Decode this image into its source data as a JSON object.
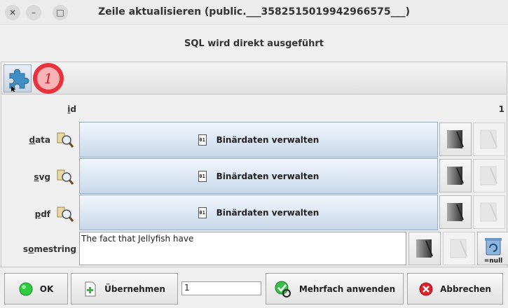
{
  "window": {
    "title": "Zeile aktualisieren (public.___3582515019942966575___)",
    "close_glyph": "✕",
    "minimize_glyph": "–",
    "maximize_glyph": "□"
  },
  "subtitle": "SQL wird direkt ausgeführt",
  "toolbar": {
    "badge_number": "1"
  },
  "fields": {
    "id": {
      "label_prefix": "",
      "label_mnemonic": "i",
      "label_rest": "d",
      "value": "1"
    },
    "data": {
      "label_prefix": "",
      "label_mnemonic": "d",
      "label_rest": "ata",
      "button": "Binärdaten verwalten"
    },
    "svg": {
      "label_prefix": "",
      "label_mnemonic": "s",
      "label_rest": "vg",
      "button": "Binärdaten verwalten"
    },
    "pdf": {
      "label_prefix": "",
      "label_mnemonic": "p",
      "label_rest": "df",
      "button": "Binärdaten verwalten"
    },
    "somestring": {
      "label_prefix": "s",
      "label_mnemonic": "o",
      "label_rest": "mestring",
      "value": "The fact that Jellyfish have"
    }
  },
  "file_icon_text": "01",
  "null_label": "=null",
  "bottom": {
    "ok": "OK",
    "apply": "Übernehmen",
    "count_value": "1",
    "multi_apply": "Mehrfach anwenden",
    "cancel": "Abbrechen"
  },
  "colors": {
    "accent_badge": "#e8323c",
    "ok_green": "#2ecc40",
    "cancel_red": "#e0202a"
  }
}
